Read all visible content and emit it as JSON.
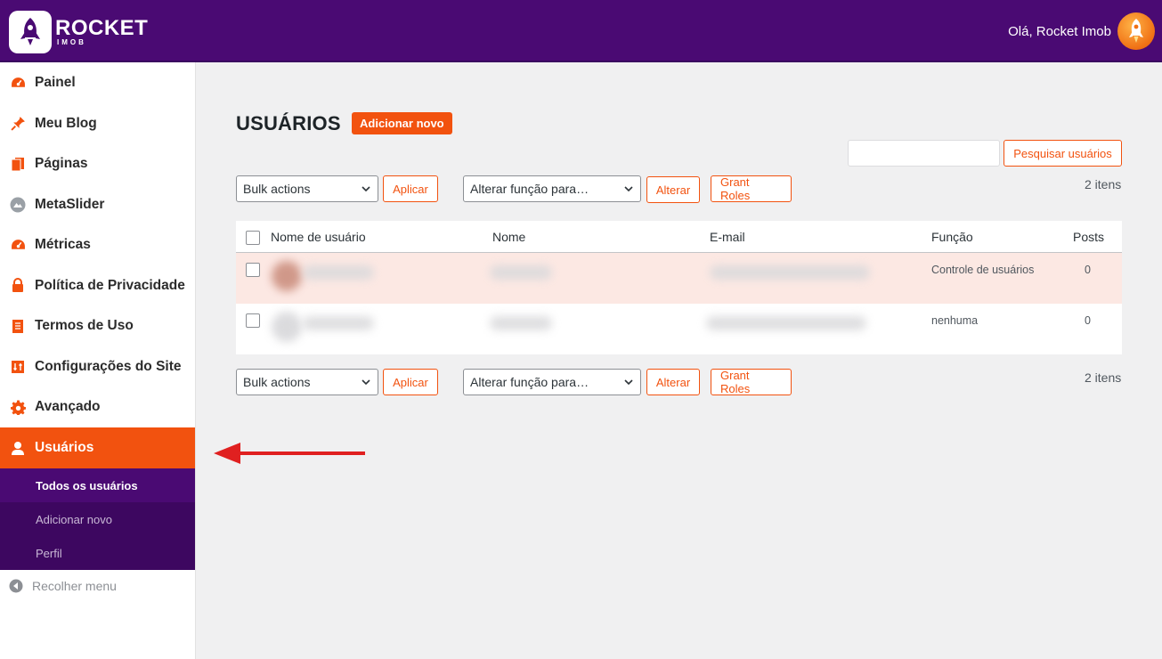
{
  "header": {
    "logo_line1": "ROCKET",
    "logo_line2": "IMOB",
    "greeting": "Olá, Rocket Imob",
    "icons": {
      "logo": "rocket-icon",
      "avatar": "rocket-avatar-icon"
    }
  },
  "sidebar": {
    "items": [
      {
        "label": "Painel",
        "icon": "dashboard-icon"
      },
      {
        "label": "Meu Blog",
        "icon": "pin-icon"
      },
      {
        "label": "Páginas",
        "icon": "pages-icon"
      },
      {
        "label": "MetaSlider",
        "icon": "slider-icon"
      },
      {
        "label": "Métricas",
        "icon": "metrics-icon"
      },
      {
        "label": "Política de Privacidade",
        "icon": "lock-icon"
      },
      {
        "label": "Termos de Uso",
        "icon": "document-icon"
      },
      {
        "label": "Configurações do Site",
        "icon": "settings-sliders-icon"
      },
      {
        "label": "Avançado",
        "icon": "gear-icon"
      },
      {
        "label": "Usuários",
        "icon": "user-icon",
        "active": true
      }
    ],
    "submenu": [
      {
        "label": "Todos os usuários",
        "current": true
      },
      {
        "label": "Adicionar novo"
      },
      {
        "label": "Perfil"
      }
    ],
    "collapse_label": "Recolher menu"
  },
  "main": {
    "title": "USUÁRIOS",
    "add_new_label": "Adicionar novo",
    "search_value": "",
    "search_button": "Pesquisar usuários",
    "top_actions": {
      "bulk_select": "Bulk actions",
      "apply": "Aplicar",
      "role_select": "Alterar função para…",
      "change": "Alterar",
      "grant_roles": "Grant Roles",
      "count": "2 itens"
    },
    "bottom_actions": {
      "bulk_select": "Bulk actions",
      "apply": "Aplicar",
      "role_select": "Alterar função para…",
      "change": "Alterar",
      "grant_roles": "Grant Roles",
      "count": "2 itens"
    },
    "table": {
      "columns": [
        "Nome de usuário",
        "Nome",
        "E-mail",
        "Função",
        "Posts"
      ],
      "rows": [
        {
          "role": "Controle de usuários",
          "posts": "0"
        },
        {
          "role": "nenhuma",
          "posts": "0"
        }
      ]
    }
  },
  "colors": {
    "header_bg": "#4a0a73",
    "accent": "#f2520f",
    "submenu_bg": "#3d0760",
    "highlight_row": "#fce8e3",
    "arrow": "#e02020"
  }
}
